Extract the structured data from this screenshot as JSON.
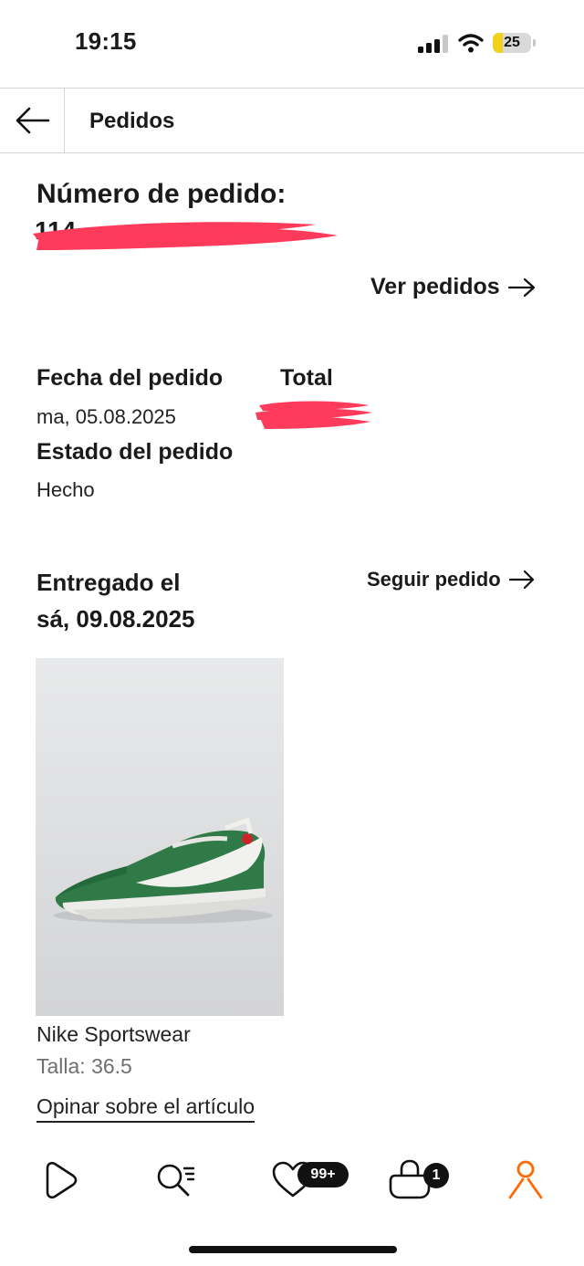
{
  "status_bar": {
    "time": "19:15",
    "battery": "25",
    "battery_level": 0.25
  },
  "header": {
    "title": "Pedidos"
  },
  "order": {
    "number_label": "Número de pedido:",
    "see_orders": "Ver pedidos",
    "date_label": "Fecha del pedido",
    "date_value": "ma, 05.08.2025",
    "total_label": "Total",
    "status_label": "Estado del pedido",
    "status_value": "Hecho"
  },
  "delivery": {
    "line1": "Entregado el",
    "line2": "sá, 09.08.2025",
    "track": "Seguir pedido"
  },
  "item": {
    "brand": "Nike Sportswear",
    "size": "Talla: 36.5",
    "review": "Opinar sobre el artículo"
  },
  "bottom_nav": {
    "wishlist_badge": "99+",
    "bag_badge": "1",
    "accent_color": "#ff6900"
  },
  "colors": {
    "redaction": "#ff3b5c"
  }
}
